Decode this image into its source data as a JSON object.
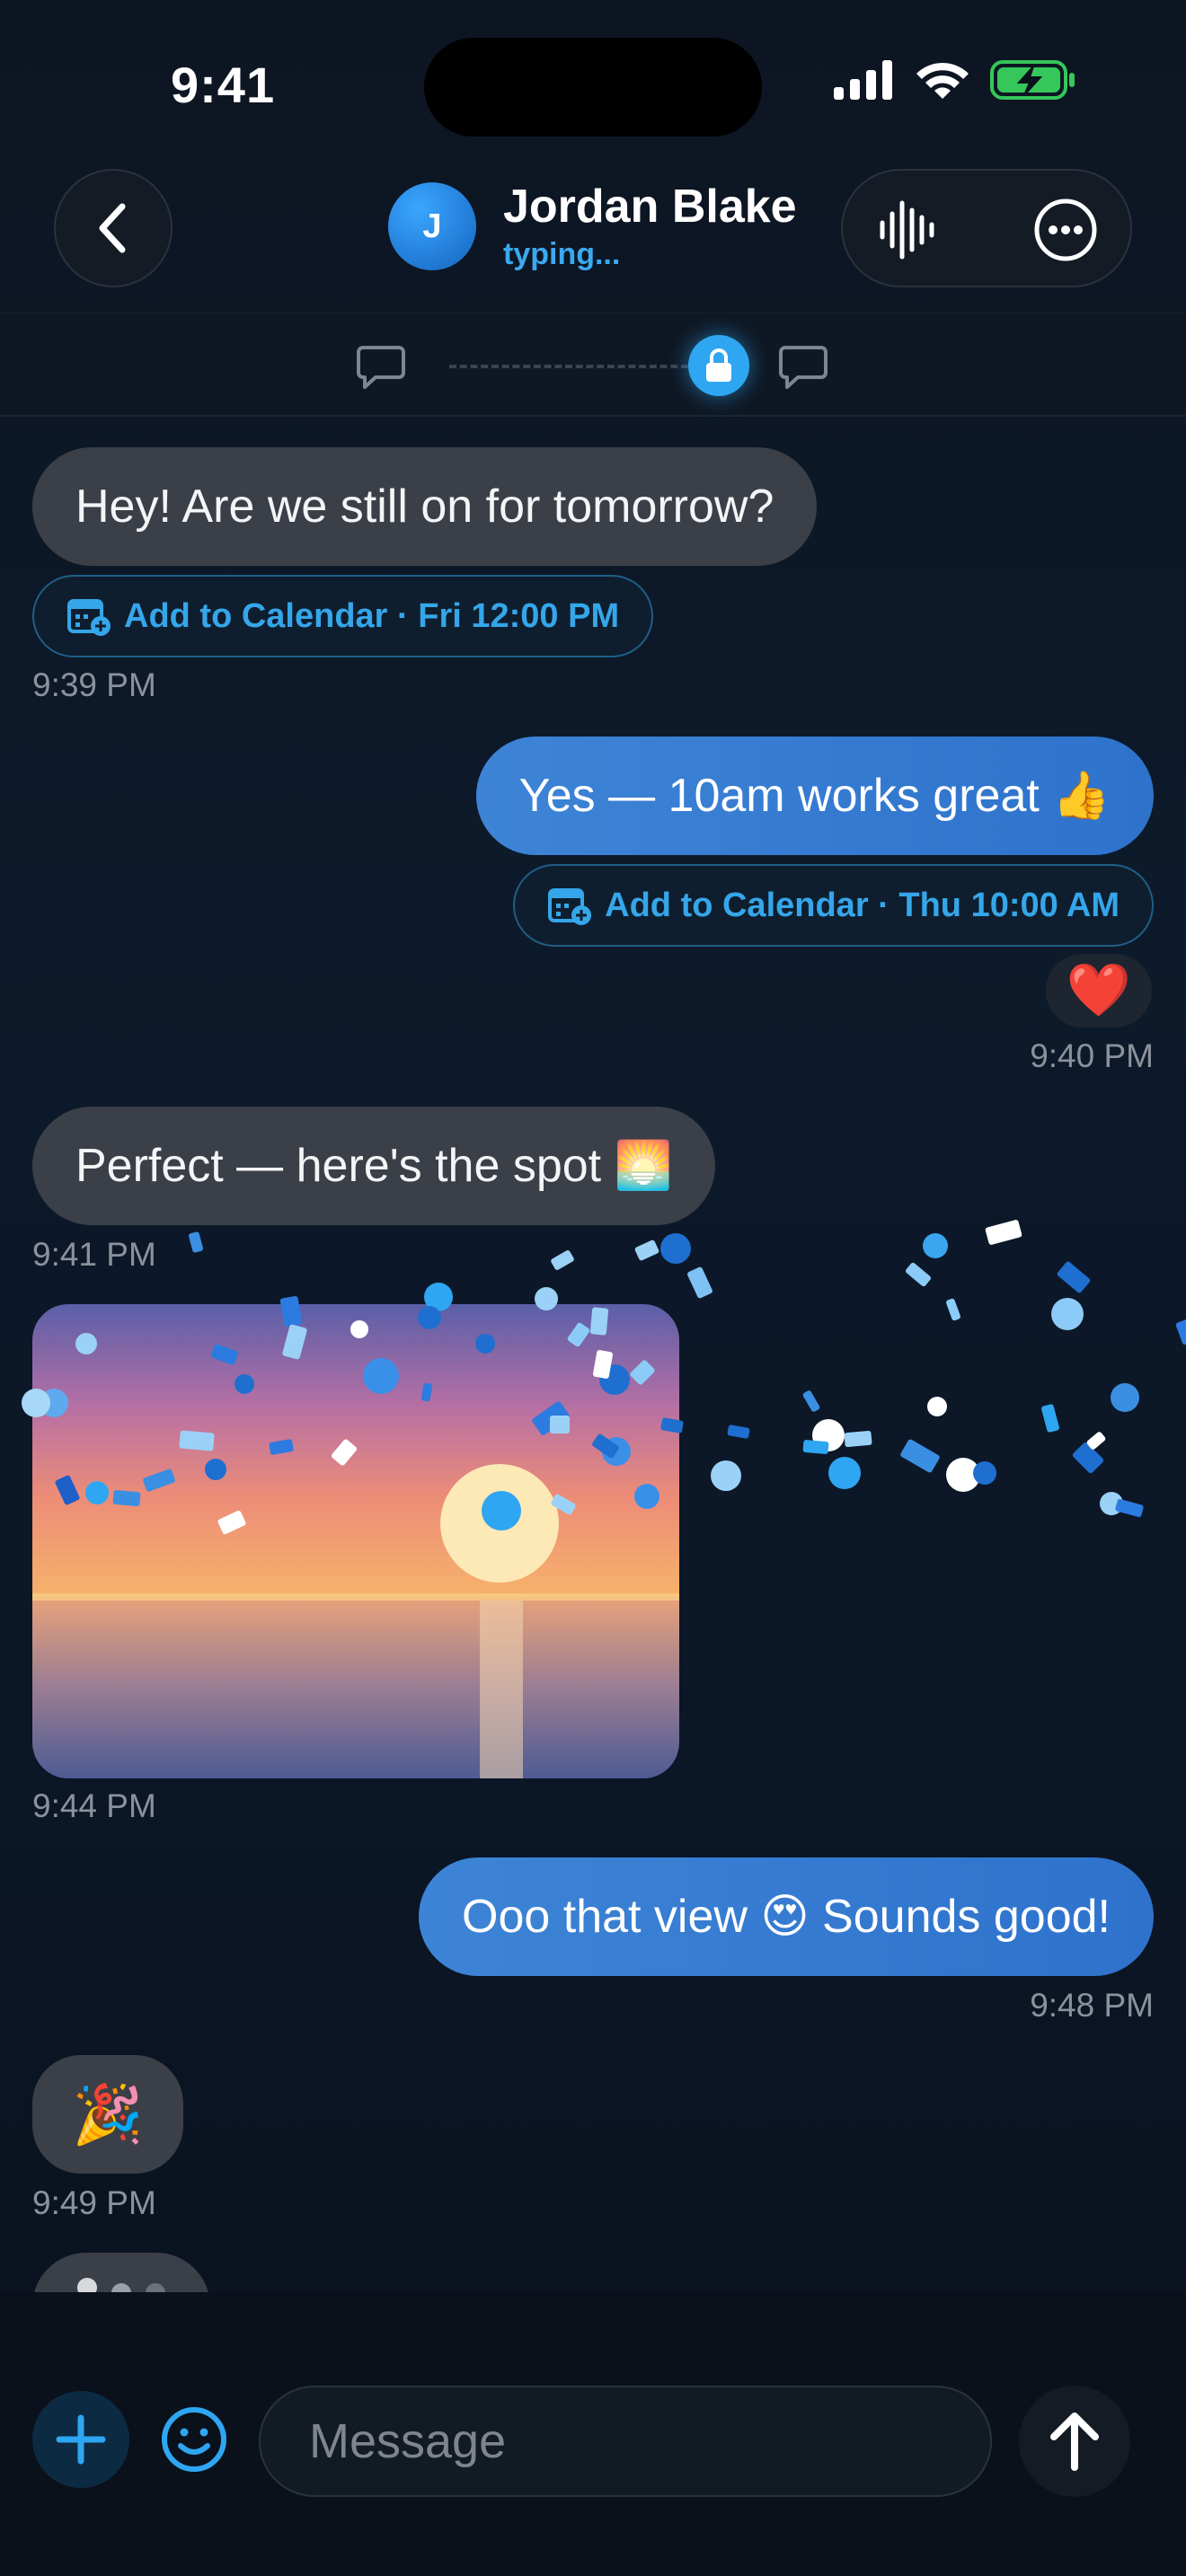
{
  "status_bar": {
    "time": "9:41",
    "icons": [
      "cellular-signal-icon",
      "wifi-icon",
      "battery-charging-icon"
    ]
  },
  "header": {
    "back_icon": "chevron-left-icon",
    "avatar_initial": "J",
    "contact_name": "Jordan Blake",
    "contact_status": "typing...",
    "actions": [
      "waveform-icon",
      "more-ellipsis-icon"
    ]
  },
  "encryption": {
    "icons": [
      "chat-bubble-icon",
      "lock-icon",
      "chat-bubble-icon"
    ]
  },
  "messages": [
    {
      "direction": "incoming",
      "text": "Hey! Are we still on for tomorrow?",
      "calendar_chip": "Add to Calendar · Fri 12:00 PM",
      "time": "9:39 PM"
    },
    {
      "direction": "outgoing",
      "text": "Yes — 10am works great 👍",
      "calendar_chip": "Add to Calendar · Thu 10:00 AM",
      "reaction": "❤️",
      "time": "9:40 PM"
    },
    {
      "direction": "incoming",
      "text": "Perfect — here's the spot 🌅",
      "time": "9:41 PM"
    },
    {
      "direction": "incoming",
      "type": "photo",
      "photo_subject": "sunset over water",
      "time": "9:44 PM"
    },
    {
      "direction": "outgoing",
      "text": "Ooo that view 😍 Sounds good!",
      "time": "9:48 PM"
    },
    {
      "direction": "incoming",
      "text": "🎉",
      "time": "9:49 PM"
    }
  ],
  "typing_indicator": true,
  "composer": {
    "placeholder": "Message",
    "value": "",
    "buttons": [
      "plus-icon",
      "smiley-icon",
      "arrow-up-icon"
    ]
  },
  "colors": {
    "accent": "#2ea6f2",
    "outgoing_bubble": "#3a7fd5",
    "incoming_bubble": "#3b3f47",
    "background": "#0d1521"
  }
}
